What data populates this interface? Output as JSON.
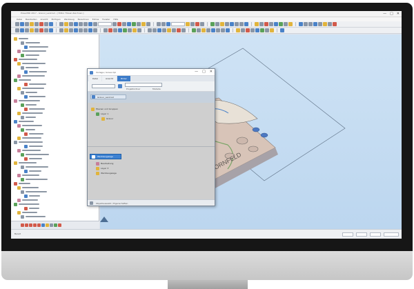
{
  "app": {
    "title": "PowerMill 2017 - Gravur_Lenkrad - [ Editor Fräsen Zeichnen ]",
    "window_buttons": [
      "—",
      "□",
      "✕"
    ],
    "menu": [
      "Datei",
      "Bearbeiten",
      "Ansicht",
      "Einfügen",
      "Werkzeug",
      "Berechnen",
      "Extras",
      "Fenster",
      "Hilfe"
    ]
  },
  "dialog": {
    "title": "Vorlage / Gravur.tpl",
    "tabs": [
      "Datei",
      "Ansicht",
      "Bilder"
    ],
    "active_tab": "Bilder",
    "row_label_1": "Projektordner",
    "row_label_2": "Modelle",
    "header_selected": "Gravur_Lenkrad",
    "tree_top": [
      "Ebenen und Gruppen",
      "Layer 1",
      "Gravur"
    ],
    "selected_item": "Werkzeugwege",
    "tree_bottom": [
      "Bearbeitung",
      "Layer 3",
      "Werkzeugwege"
    ],
    "footer": "Objektauswahl / Eigenschaften"
  },
  "status": {
    "left_text": "Bereit"
  },
  "viewport": {
    "model_text": "KORNFELD"
  },
  "colors": {
    "viewport_top": "#cfe3f5",
    "viewport_bottom": "#bcd6ef",
    "model_top": "#d8c4b8",
    "model_side": "#a7a2a8",
    "selection_blue": "#3e82d2",
    "text_blue": "#4a82c8"
  },
  "icons": [
    "minimize-icon",
    "maximize-icon",
    "close-icon",
    "folder-icon",
    "gear-icon",
    "layer-icon"
  ]
}
